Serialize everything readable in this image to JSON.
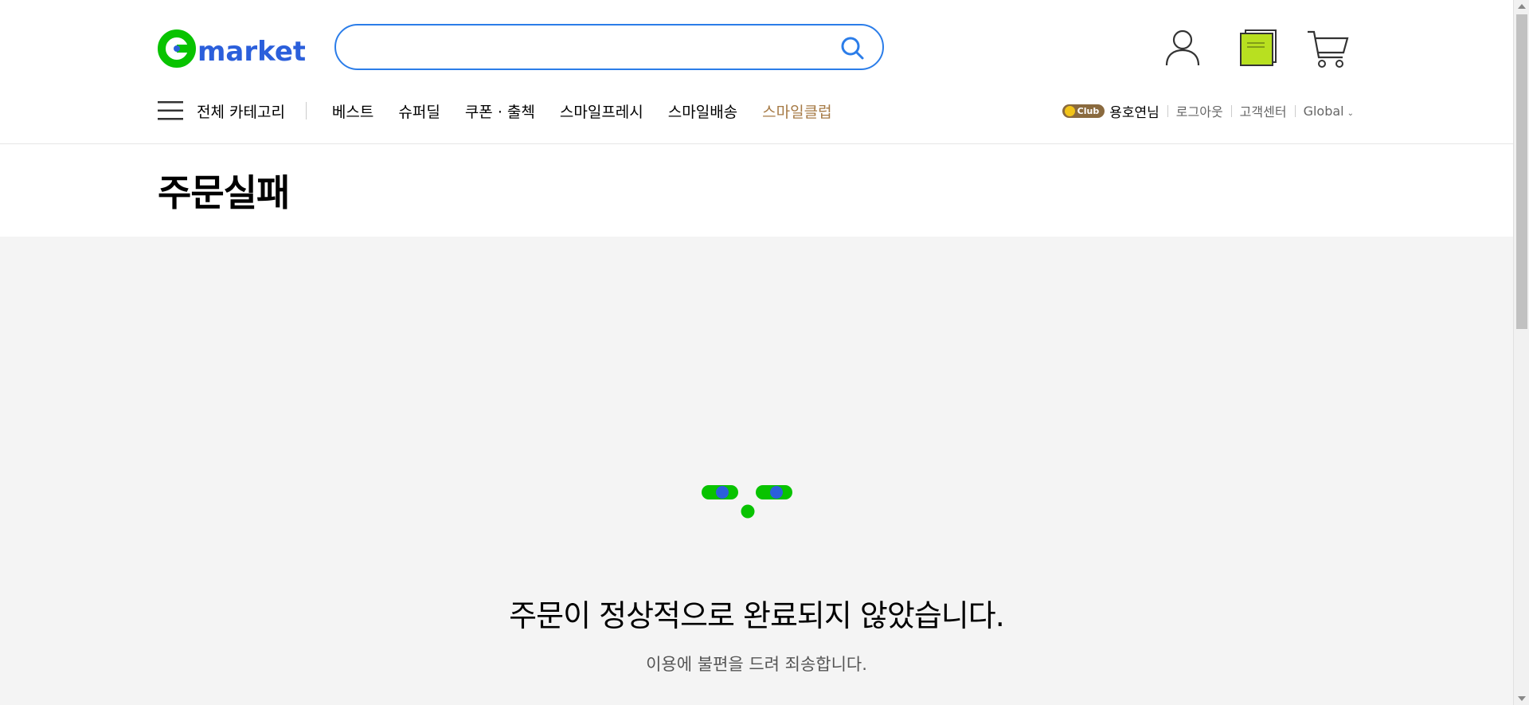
{
  "header": {
    "logo_text": "Gmarket",
    "search": {
      "value": "",
      "placeholder": ""
    },
    "icons": [
      "search-icon",
      "user-icon",
      "coupon-book-icon",
      "cart-icon"
    ]
  },
  "nav": {
    "all_categories": "전체 카테고리",
    "items": [
      "베스트",
      "슈퍼딜",
      "쿠폰 · 출첵",
      "스마일프레시",
      "스마일배송"
    ],
    "club": "스마일클럽"
  },
  "user_nav": {
    "club_badge": "Club",
    "username": "용호연님",
    "logout": "로그아웃",
    "customer_center": "고객센터",
    "global": "Global"
  },
  "page": {
    "title": "주문실패",
    "message": "주문이 정상적으로 완료되지 않았습니다.",
    "submessage": "이용에 불편을 드려 죄송합니다."
  },
  "colors": {
    "brand_green": "#08c300",
    "brand_blue": "#2b5fdb",
    "search_border": "#2b7de9",
    "club_text": "#a67a45"
  }
}
